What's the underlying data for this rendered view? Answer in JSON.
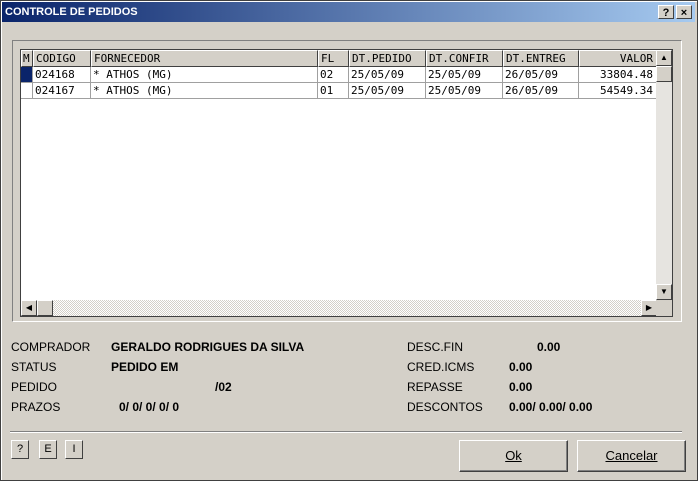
{
  "window": {
    "title": "CONTROLE DE PEDIDOS",
    "help_btn": "?",
    "close_btn": "×"
  },
  "grid": {
    "columns": [
      "M",
      "CODIGO",
      "FORNECEDOR",
      "FL",
      "DT.PEDIDO",
      "DT.CONFIR",
      "DT.ENTREG",
      "VALOR"
    ],
    "rows": [
      {
        "codigo": "024168",
        "fornecedor": "* ATHOS (MG)",
        "fl": "02",
        "dt_pedido": "25/05/09",
        "dt_confir": "25/05/09",
        "dt_entreg": "26/05/09",
        "valor": "33804.48"
      },
      {
        "codigo": "024167",
        "fornecedor": "* ATHOS (MG)",
        "fl": "01",
        "dt_pedido": "25/05/09",
        "dt_confir": "25/05/09",
        "dt_entreg": "26/05/09",
        "valor": "54549.34"
      }
    ]
  },
  "details": {
    "comprador_label": "COMPRADOR",
    "comprador_value": "GERALDO RODRIGUES DA SILVA",
    "status_label": "STATUS",
    "status_value": "PEDIDO EM",
    "pedido_label": "PEDIDO",
    "pedido_value": "/02",
    "prazos_label": "PRAZOS",
    "prazos_value": "0/ 0/ 0/ 0/ 0",
    "descfin_label": "DESC.FIN",
    "descfin_value": "0.00",
    "credicms_label": "CRED.ICMS",
    "credicms_value": "0.00",
    "repasse_label": "REPASSE",
    "repasse_value": "0.00",
    "descontos_label": "DESCONTOS",
    "descontos_value": "0.00/ 0.00/ 0.00"
  },
  "buttons": {
    "help": "?",
    "e": "E",
    "i": "I",
    "ok": "Ok",
    "cancel": "Cancelar"
  }
}
